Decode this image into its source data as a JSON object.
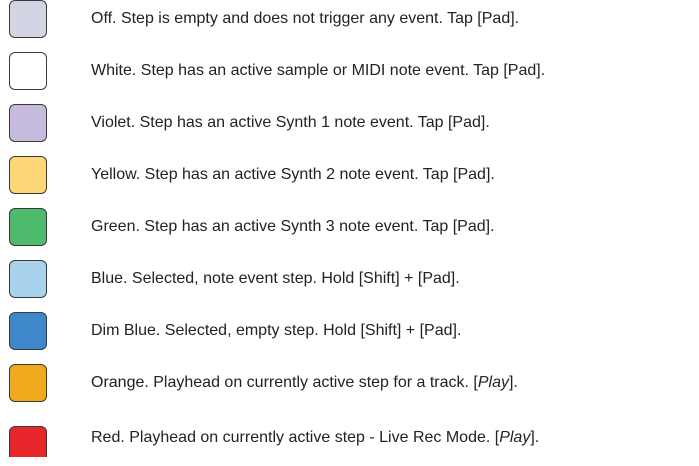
{
  "legend": [
    {
      "color": "#d3d5e5",
      "text": "Off. Step is empty and does not trigger any event. Tap [Pad]."
    },
    {
      "color": "#ffffff",
      "text": "White. Step has an active sample or MIDI note event. Tap [Pad]."
    },
    {
      "color": "#c7bbdd",
      "text": "Violet. Step has an active Synth 1 note event. Tap [Pad]."
    },
    {
      "color": "#fdd775",
      "text": "Yellow. Step has an active Synth 2 note event. Tap [Pad]."
    },
    {
      "color": "#4dbb6b",
      "text": "Green. Step has an active Synth 3 note event. Tap [Pad]."
    },
    {
      "color": "#a9d2ee",
      "text": "Blue. Selected, note event step. Hold [Shift] + [Pad]."
    },
    {
      "color": "#3f87cb",
      "text": "Dim Blue. Selected, empty step. Hold [Shift] + [Pad]."
    },
    {
      "color": "#f0a91d",
      "text_before": "Orange. Playhead on currently active step for a track. [",
      "text_em": "Play",
      "text_after": "]."
    },
    {
      "color": "#e8272d",
      "text_before": "Red. Playhead on currently active step - Live Rec Mode. [",
      "text_em": "Play",
      "text_after": "]."
    }
  ]
}
